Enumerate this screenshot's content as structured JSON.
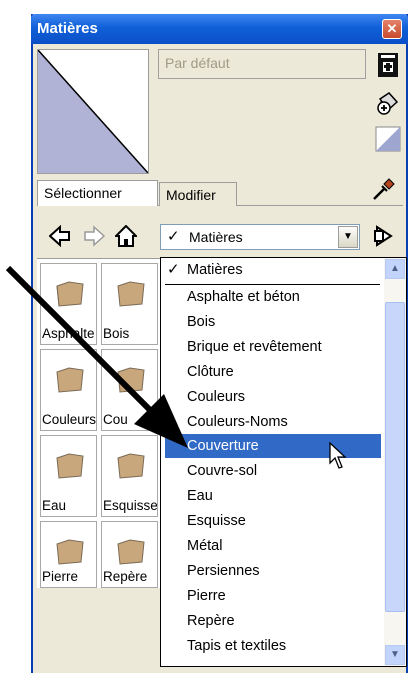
{
  "window": {
    "title": "Matières"
  },
  "preview": {
    "name_placeholder": "Par défaut"
  },
  "tabs": [
    {
      "label": "Sélectionner",
      "active": true
    },
    {
      "label": "Modifier",
      "active": false
    }
  ],
  "library": {
    "selected": "Matières"
  },
  "grid": {
    "items": [
      "Asphalte",
      "Bois",
      "Couleurs",
      "Cou",
      "Eau",
      "Esquisse",
      "Pierre",
      "Repère"
    ]
  },
  "dropdown": {
    "items": [
      "Matières",
      "Asphalte et béton",
      "Bois",
      "Brique et revêtement",
      "Clôture",
      "Couleurs",
      "Couleurs-Noms",
      "Couverture",
      "Couvre-sol",
      "Eau",
      "Esquisse",
      "Métal",
      "Persiennes",
      "Pierre",
      "Repère",
      "Tapis et textiles"
    ],
    "checked_index": 0,
    "highlighted_index": 7
  },
  "colors": {
    "title_bar": "#0b4fc8",
    "highlight": "#3169c6",
    "face": "#ece9d8",
    "folder": "#c9a77c"
  }
}
